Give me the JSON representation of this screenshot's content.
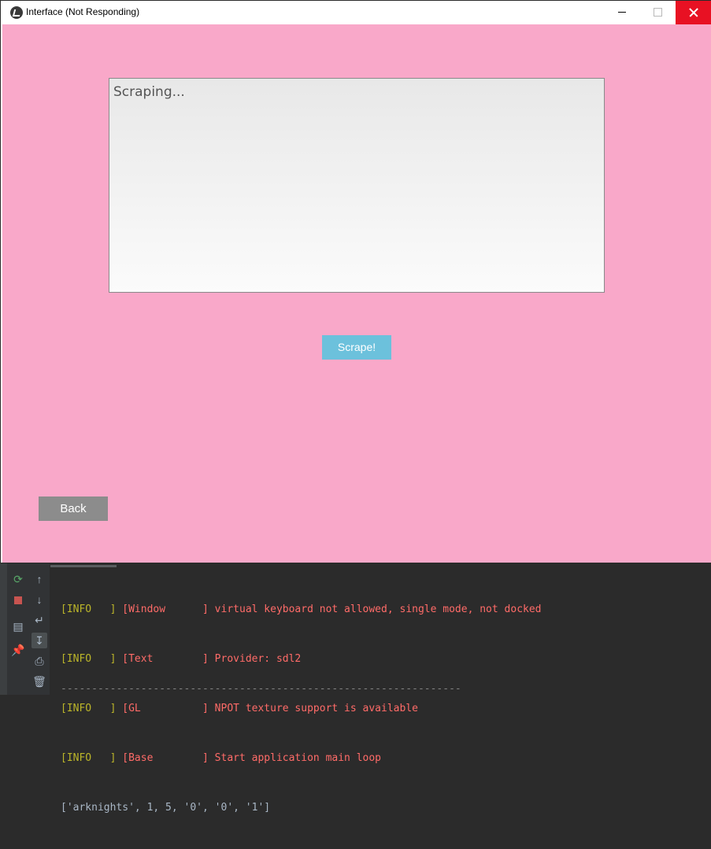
{
  "window": {
    "title": "Interface (Not Responding)"
  },
  "main": {
    "output_text": "Scraping...",
    "scrape_label": "Scrape!",
    "back_label": "Back"
  },
  "console": {
    "lines": [
      {
        "level": "[INFO   ]",
        "source": " [Window      ]",
        "message": " virtual keyboard not allowed, single mode, not docked"
      },
      {
        "level": "[INFO   ]",
        "source": " [Text        ]",
        "message": " Provider: sdl2"
      },
      {
        "level": "[INFO   ]",
        "source": " [GL          ]",
        "message": " NPOT texture support is available"
      },
      {
        "level": "[INFO   ]",
        "source": " [Base        ]",
        "message": " Start application main loop"
      }
    ],
    "output_line": "['arknights', 1, 5, '0', '0', '1']",
    "separator": "-----------------------------------------------------------------"
  },
  "colors": {
    "background": "#f9a8c9",
    "scrape_button": "#6cc1dc",
    "back_button": "#8c8c8c",
    "close_button": "#e81123"
  }
}
